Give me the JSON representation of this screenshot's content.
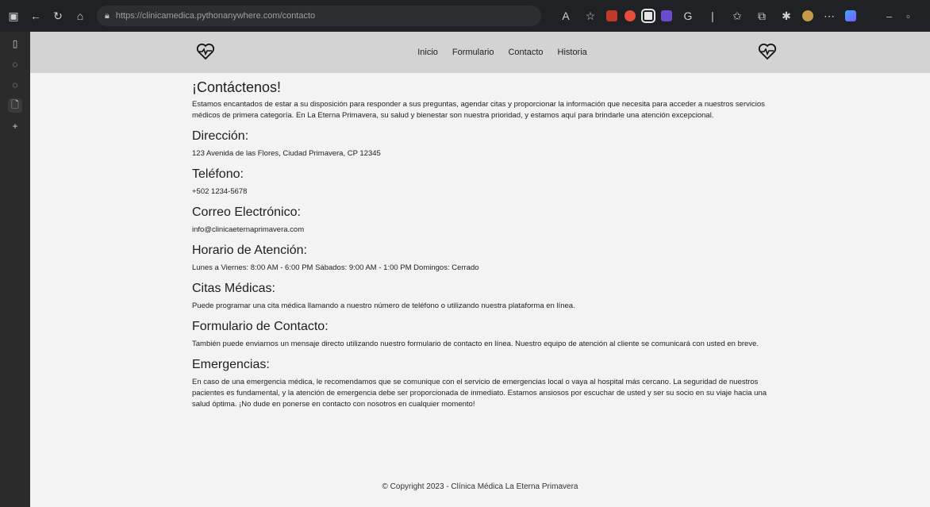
{
  "browser": {
    "url": "https://clinicamedica.pythonanywhere.com/contacto",
    "icons": [
      "tabs-icon",
      "back-icon",
      "refresh-icon",
      "home-icon"
    ],
    "colors": {
      "chrome": "#202124",
      "page_bg": "#f3f3f3",
      "navbar_bg": "#d3d3d3"
    }
  },
  "nav": {
    "items": [
      "Inicio",
      "Formulario",
      "Contacto",
      "Historia"
    ]
  },
  "content": {
    "title": "¡Contáctenos!",
    "intro": "Estamos encantados de estar a su disposición para responder a sus preguntas, agendar citas y proporcionar la información que necesita para acceder a nuestros servicios médicos de primera categoría. En La Eterna Primavera, su salud y bienestar son nuestra prioridad, y estamos aquí para brindarle una atención excepcional.",
    "sections": [
      {
        "heading": "Dirección:",
        "text": "123 Avenida de las Flores, Ciudad Primavera, CP 12345"
      },
      {
        "heading": "Teléfono:",
        "text": "+502 1234-5678"
      },
      {
        "heading": "Correo Electrónico:",
        "text": "info@clinicaeternaprimavera.com"
      },
      {
        "heading": "Horario de Atención:",
        "text": "Lunes a Viernes: 8:00 AM - 6:00 PM Sábados: 9:00 AM - 1:00 PM Domingos: Cerrado"
      },
      {
        "heading": "Citas Médicas:",
        "text": "Puede programar una cita médica llamando a nuestro número de teléfono o utilizando nuestra plataforma en línea."
      },
      {
        "heading": "Formulario de Contacto:",
        "text": "También puede enviarnos un mensaje directo utilizando nuestro formulario de contacto en línea. Nuestro equipo de atención al cliente se comunicará con usted en breve."
      },
      {
        "heading": "Emergencias:",
        "text": "En caso de una emergencia médica, le recomendamos que se comunique con el servicio de emergencias local o vaya al hospital más cercano. La seguridad de nuestros pacientes es fundamental, y la atención de emergencia debe ser proporcionada de inmediato. Estamos ansiosos por escuchar de usted y ser su socio en su viaje hacia una salud óptima. ¡No dude en ponerse en contacto con nosotros en cualquier momento!"
      }
    ]
  },
  "footer": {
    "text": "© Copyright 2023 - Clínica Médica La Eterna Primavera"
  }
}
